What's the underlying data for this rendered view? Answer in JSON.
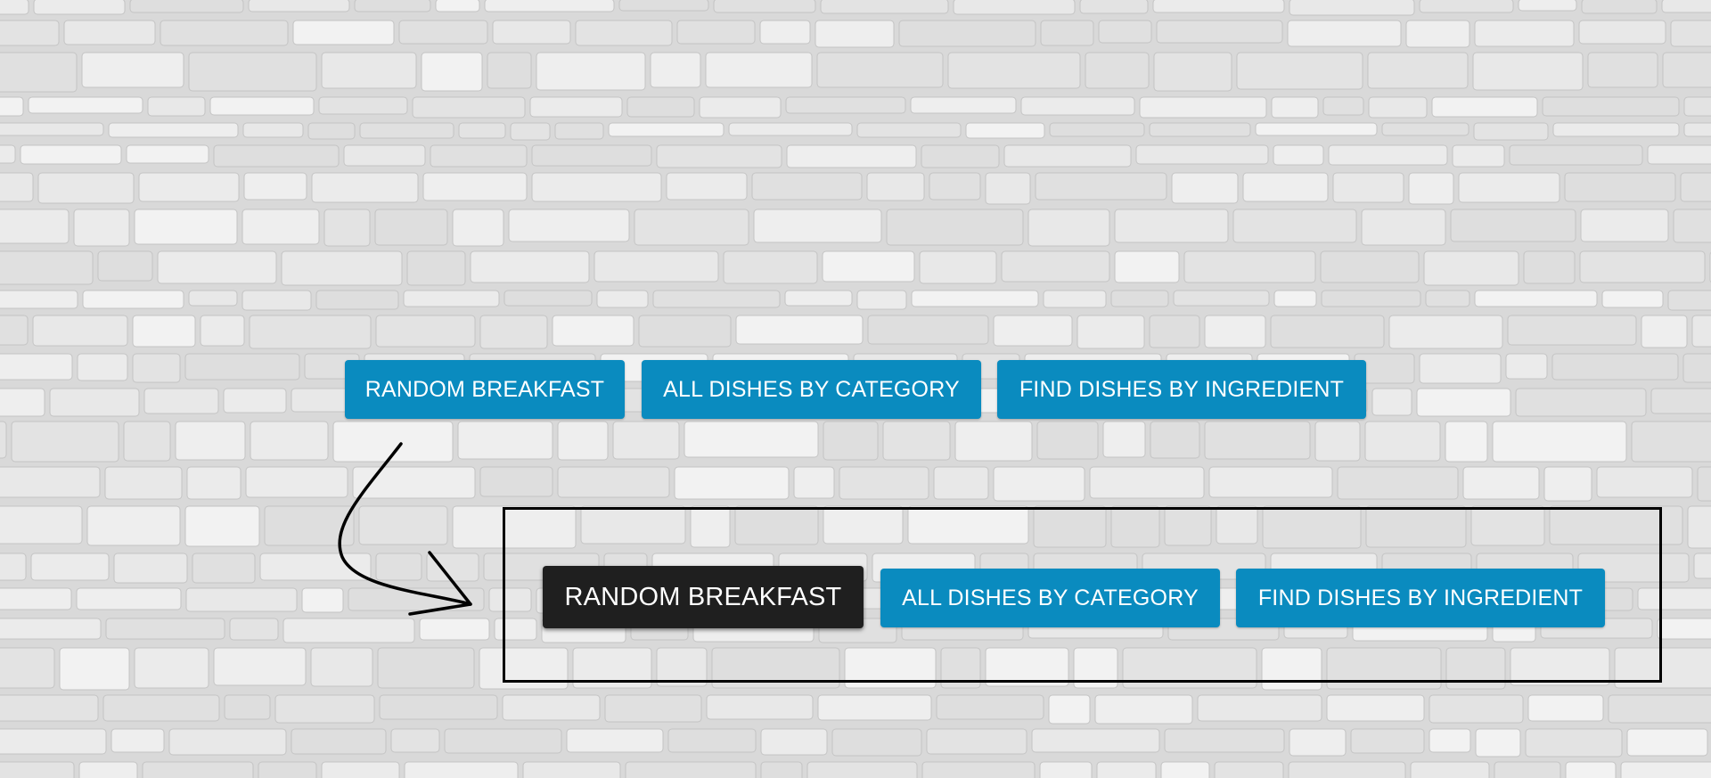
{
  "top_nav": {
    "random_breakfast": "RANDOM BREAKFAST",
    "all_dishes_by_category": "ALL DISHES BY CATEGORY",
    "find_dishes_by_ingredient": "FIND DISHES BY INGREDIENT"
  },
  "active_nav": {
    "random_breakfast": "RANDOM BREAKFAST",
    "all_dishes_by_category": "ALL DISHES BY CATEGORY",
    "find_dishes_by_ingredient": "FIND DISHES BY INGREDIENT"
  },
  "colors": {
    "button_blue": "#0a8bbf",
    "button_active": "#1f1f1f",
    "button_text": "#ffffff",
    "annotation": "#000000"
  },
  "icons": {
    "arrow": "curved-arrow-icon"
  }
}
